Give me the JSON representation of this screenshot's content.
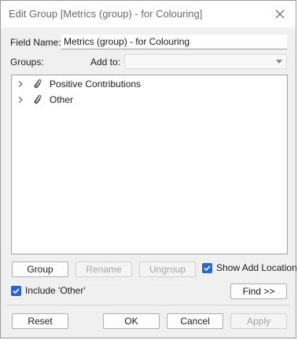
{
  "window": {
    "title": "Edit Group [Metrics (group) - for Colouring]"
  },
  "field_name": {
    "label": "Field Name:",
    "value": "Metrics (group) - for Colouring"
  },
  "groups": {
    "label": "Groups:",
    "add_to_label": "Add to:",
    "add_to_value": "",
    "items": [
      {
        "label": "Positive Contributions"
      },
      {
        "label": "Other"
      }
    ]
  },
  "actions": {
    "group": "Group",
    "rename": "Rename",
    "ungroup": "Ungroup",
    "show_add_location": "Show Add Location",
    "include_other": "Include 'Other'",
    "find": "Find >>"
  },
  "footer": {
    "reset": "Reset",
    "ok": "OK",
    "cancel": "Cancel",
    "apply": "Apply"
  },
  "colors": {
    "accent": "#2a66c8",
    "dialog_bg": "#f0f0f0",
    "disabled_text": "#a4a4a4"
  },
  "icons": {
    "close": "close-icon",
    "expander": "chevron-right-icon",
    "group_item": "paperclip-icon",
    "dropdown": "chevron-down-icon",
    "checkbox": "checkmark-icon"
  },
  "state": {
    "show_add_location_checked": true,
    "include_other_checked": true
  }
}
